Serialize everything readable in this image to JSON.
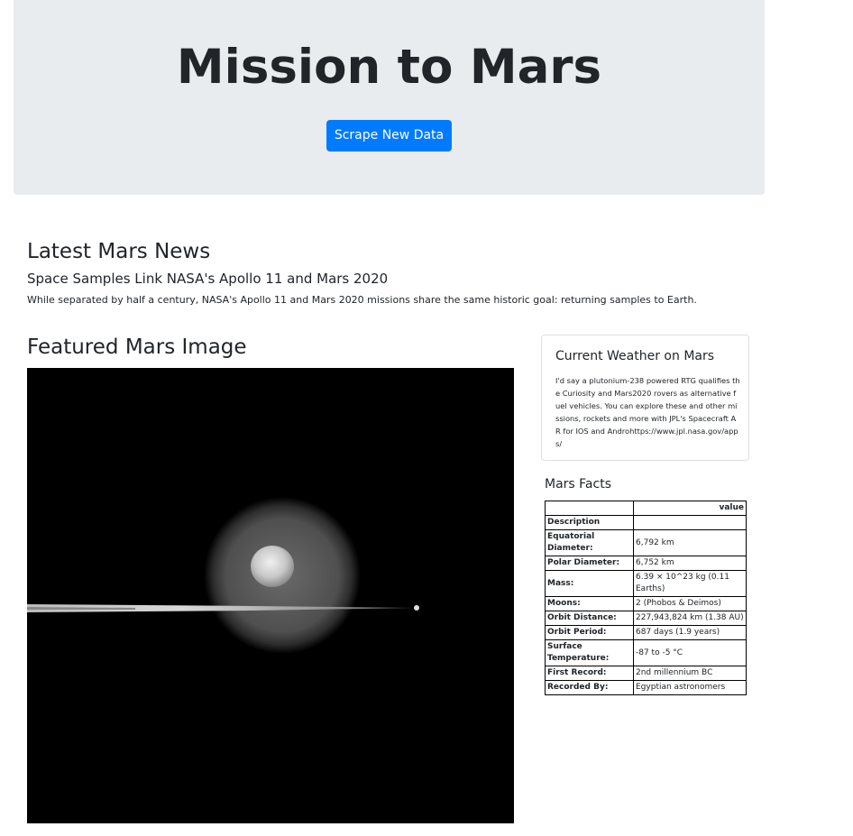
{
  "header": {
    "title": "Mission to Mars",
    "scrape_button_label": "Scrape New Data",
    "accent_color": "#007bff",
    "background_color": "#e9ecef"
  },
  "news": {
    "heading": "Latest Mars News",
    "title": "Space Samples Link NASA's Apollo 11 and Mars 2020",
    "paragraph": "While separated by half a century, NASA's Apollo 11 and Mars 2020 missions share the same historic goal: returning samples to Earth."
  },
  "featured": {
    "heading": "Featured Mars Image"
  },
  "weather": {
    "title": "Current Weather on Mars",
    "text": "I'd say a plutonium-238 powered RTG qualifies the Curiosity and Mars2020 rovers as alternative fuel vehicles. You can explore these and other missions, rockets and more with JPL's Spacecraft AR for IOS and Androhttps://www.jpl.nasa.gov/apps/"
  },
  "facts": {
    "heading": "Mars Facts",
    "column_header": "value",
    "rows": [
      {
        "label": "Description",
        "value": ""
      },
      {
        "label": "Equatorial Diameter:",
        "value": "6,792 km"
      },
      {
        "label": "Polar Diameter:",
        "value": "6,752 km"
      },
      {
        "label": "Mass:",
        "value": "6.39 × 10^23 kg (0.11 Earths)"
      },
      {
        "label": "Moons:",
        "value": "2 (Phobos & Deimos)"
      },
      {
        "label": "Orbit Distance:",
        "value": "227,943,824 km (1.38 AU)"
      },
      {
        "label": "Orbit Period:",
        "value": "687 days (1.9 years)"
      },
      {
        "label": "Surface Temperature:",
        "value": "-87 to -5 °C"
      },
      {
        "label": "First Record:",
        "value": "2nd millennium BC"
      },
      {
        "label": "Recorded By:",
        "value": "Egyptian astronomers"
      }
    ]
  }
}
